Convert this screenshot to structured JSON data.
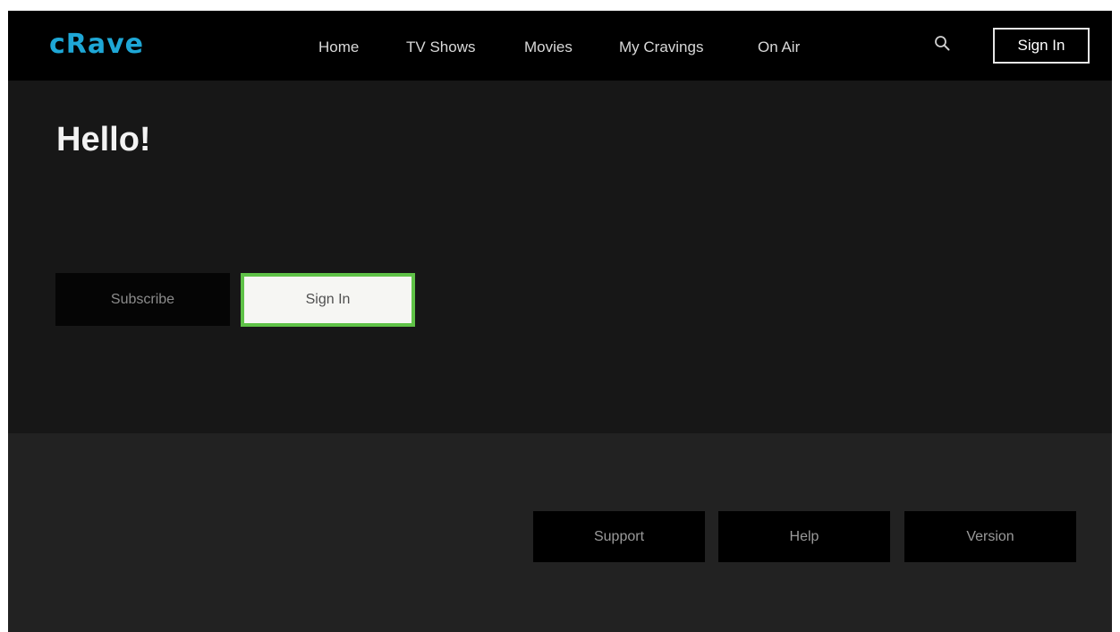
{
  "header": {
    "logo": "cRave",
    "nav": [
      {
        "label": "Home"
      },
      {
        "label": "TV Shows"
      },
      {
        "label": "Movies"
      },
      {
        "label": "My Cravings"
      },
      {
        "label": "On Air"
      }
    ],
    "search_icon": "search-icon",
    "sign_in_label": "Sign In"
  },
  "main": {
    "greeting": "Hello!",
    "subscribe_label": "Subscribe",
    "sign_in_label": "Sign In"
  },
  "footer": {
    "links": [
      {
        "label": "Support"
      },
      {
        "label": "Help"
      },
      {
        "label": "Version"
      }
    ]
  },
  "colors": {
    "brand": "#1ea7d6",
    "focus_border": "#5fc247",
    "background": "#171717",
    "topbar": "#000000",
    "footer": "#222222"
  }
}
